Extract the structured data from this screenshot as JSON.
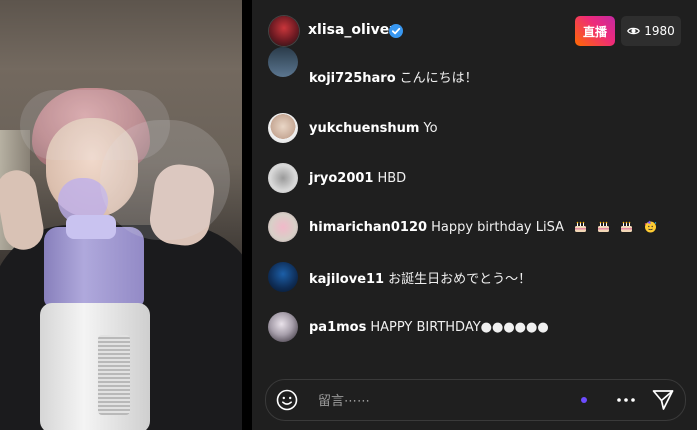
{
  "header": {
    "host_name": "xlisa_olivex",
    "live_label": "直播",
    "viewer_count": "1980"
  },
  "comments": [
    {
      "user": "koji725haro",
      "message": "こんにちは！"
    },
    {
      "user": "yukchuenshum",
      "message": "Yo"
    },
    {
      "user": "jryo2001",
      "message": "HBD"
    },
    {
      "user": "himarichan0120",
      "message": "Happy birthday LiSA"
    },
    {
      "user": "kajilove11",
      "message": "お誕生日おめでとう〜！"
    },
    {
      "user": "pa1mos",
      "message": "HAPPY BIRTHDAY●●●●●●"
    }
  ],
  "input": {
    "placeholder": "留言⋯⋯"
  },
  "icons": {
    "verified": "verified-badge-icon",
    "viewers": "eye-icon",
    "emoji": "smiley-icon",
    "more": "more-icon",
    "send": "send-icon",
    "cake": "cake-emoji",
    "party": "party-face-emoji"
  },
  "colors": {
    "accent_purple": "#6d4cff",
    "verified_blue": "#3897f0",
    "panel_bg": "#1f1f1f"
  }
}
